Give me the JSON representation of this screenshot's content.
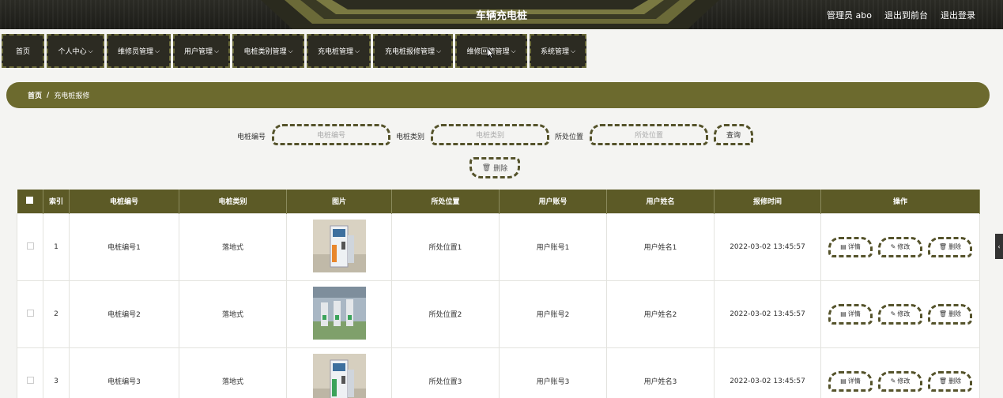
{
  "header": {
    "title": "车辆充电桩",
    "user": "管理员 abo",
    "front": "退出到前台",
    "logout": "退出登录"
  },
  "nav": [
    {
      "label": "首页",
      "dropdown": false
    },
    {
      "label": "个人中心",
      "dropdown": true
    },
    {
      "label": "维修员管理",
      "dropdown": true
    },
    {
      "label": "用户管理",
      "dropdown": true
    },
    {
      "label": "电桩类别管理",
      "dropdown": true
    },
    {
      "label": "充电桩管理",
      "dropdown": true
    },
    {
      "label": "充电桩报修管理",
      "dropdown": true
    },
    {
      "label": "维修回馈管理",
      "dropdown": true
    },
    {
      "label": "系统管理",
      "dropdown": true
    }
  ],
  "breadcrumb": {
    "home": "首页",
    "sep": "/",
    "current": "充电桩报修"
  },
  "search": {
    "label1": "电桩编号",
    "placeholder1": "电桩编号",
    "label2": "电桩类别",
    "placeholder2": "电桩类别",
    "label3": "所处位置",
    "placeholder3": "所处位置",
    "query": "查询",
    "delete": "删除"
  },
  "table": {
    "headers": [
      "索引",
      "电桩编号",
      "电桩类别",
      "图片",
      "所处位置",
      "用户账号",
      "用户姓名",
      "报修时间",
      "操作"
    ],
    "rows": [
      {
        "index": "1",
        "code": "电桩编号1",
        "type": "落地式",
        "location": "所处位置1",
        "account": "用户账号1",
        "name": "用户姓名1",
        "time": "2022-03-02 13:45:57"
      },
      {
        "index": "2",
        "code": "电桩编号2",
        "type": "落地式",
        "location": "所处位置2",
        "account": "用户账号2",
        "name": "用户姓名2",
        "time": "2022-03-02 13:45:57"
      },
      {
        "index": "3",
        "code": "电桩编号3",
        "type": "落地式",
        "location": "所处位置3",
        "account": "用户账号3",
        "name": "用户姓名3",
        "time": "2022-03-02 13:45:57"
      }
    ],
    "actions": {
      "detail": "详情",
      "edit": "修改",
      "delete": "删除"
    }
  },
  "colors": {
    "accent": "#6c6a2e",
    "header": "#1c1c18",
    "nav_bg": "#2c2b22"
  }
}
